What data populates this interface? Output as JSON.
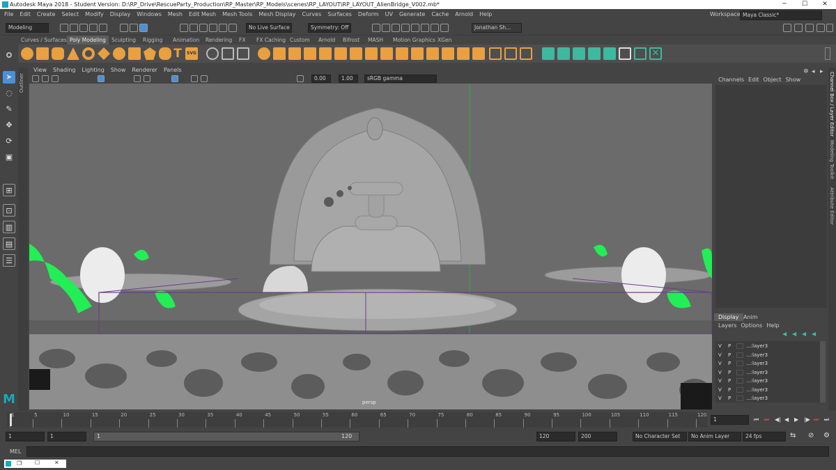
{
  "window": {
    "title": "Autodesk Maya 2018 - Student Version: D:\\RP_Drive\\RescueParty_Production\\RP_Master\\RP_Models\\scenes\\RP_LAYOUT\\RP_LAYOUT_AlienBridge_V002.mb*",
    "minimize": "─",
    "maximize": "☐",
    "close": "✕"
  },
  "menubar": {
    "items": [
      "File",
      "Edit",
      "Create",
      "Select",
      "Modify",
      "Display",
      "Windows",
      "Mesh",
      "Edit Mesh",
      "Mesh Tools",
      "Mesh Display",
      "Curves",
      "Surfaces",
      "Deform",
      "UV",
      "Generate",
      "Cache",
      "Arnold",
      "Help"
    ],
    "workspace_label": "Workspace :",
    "workspace_value": "Maya Classic*"
  },
  "statusline": {
    "menuset": "Modeling",
    "live_surface": "No Live Surface",
    "symmetry": "Symmetry: Off",
    "user": "Jonathan Sh..."
  },
  "shelf": {
    "tabs": [
      "Curves / Surfaces",
      "Poly Modeling",
      "Sculpting",
      "Rigging",
      "Animation",
      "Rendering",
      "FX",
      "FX Caching",
      "Custom",
      "Arnold",
      "Bifrost",
      "MASH",
      "Motion Graphics",
      "XGen"
    ],
    "active_tab": "Poly Modeling",
    "text_icon": "T",
    "svg_icon": "SVG"
  },
  "viewport": {
    "menus": [
      "View",
      "Shading",
      "Lighting",
      "Show",
      "Renderer",
      "Panels"
    ],
    "exposure": "0.00",
    "gamma": "1.00",
    "colorspace": "sRGB gamma",
    "camera_label": "persp",
    "outliner_tab": "Outliner"
  },
  "channelbox": {
    "menus": [
      "Channels",
      "Edit",
      "Object",
      "Show"
    ],
    "side_tabs": [
      "Channel Box / Layer Editor",
      "Modeling Toolkit",
      "Attribute Editor"
    ]
  },
  "layer_editor": {
    "tabs": [
      "Display",
      "Anim"
    ],
    "menus": [
      "Layers",
      "Options",
      "Help"
    ],
    "rows": [
      {
        "v": "V",
        "p": "P",
        "name": "...:layer3"
      },
      {
        "v": "V",
        "p": "P",
        "name": "...:layer3"
      },
      {
        "v": "V",
        "p": "P",
        "name": "...:layer3"
      },
      {
        "v": "V",
        "p": "P",
        "name": "...:layer3"
      },
      {
        "v": "V",
        "p": "P",
        "name": "...:layer3"
      },
      {
        "v": "V",
        "p": "P",
        "name": "...:layer3"
      },
      {
        "v": "V",
        "p": "P",
        "name": "...:layer3"
      }
    ]
  },
  "timeline": {
    "ticks": [
      "1",
      "5",
      "10",
      "15",
      "20",
      "25",
      "30",
      "35",
      "40",
      "45",
      "50",
      "55",
      "60",
      "65",
      "70",
      "75",
      "80",
      "85",
      "90",
      "95",
      "100",
      "105",
      "110",
      "115",
      "120"
    ],
    "current_frame": "1"
  },
  "range": {
    "start": "1",
    "playback_start": "1",
    "slider_start": "1",
    "slider_end": "120",
    "playback_end": "120",
    "end": "200",
    "character_set": "No Character Set",
    "anim_layer": "No Anim Layer",
    "fps": "24 fps"
  },
  "command": {
    "mel_label": "MEL"
  },
  "colors": {
    "ui_bg": "#444444",
    "viewport_bg": "#6b6b6b",
    "active_tab": "#5d5d5d",
    "selection_blue": "#4a90d9",
    "shelf_orange": "#e8a040",
    "shelf_teal": "#3fb8a0",
    "green_slime": "#22ee55",
    "bbox_purple": "#6a3d8a"
  }
}
